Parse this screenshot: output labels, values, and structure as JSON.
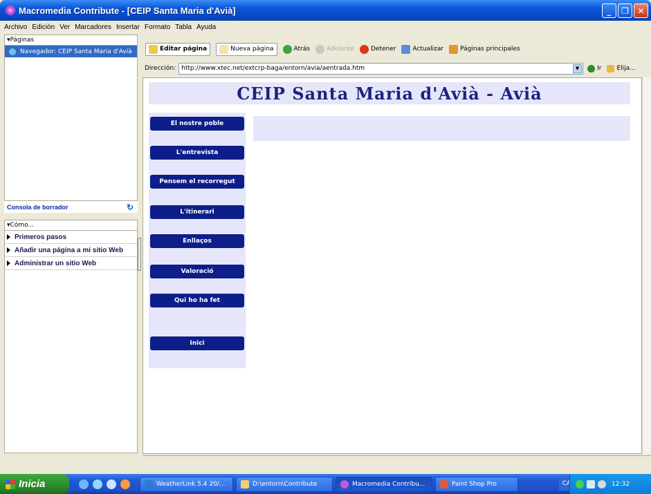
{
  "window": {
    "title": "Macromedia Contribute - [CEIP Santa Maria d'Avià]"
  },
  "menubar": [
    "Archivo",
    "Edición",
    "Ver",
    "Marcadores",
    "Insertar",
    "Formato",
    "Tabla",
    "Ayuda"
  ],
  "left": {
    "pages_header": "▾Páginas",
    "nav_item": "Navegador: CEIP Santa Maria d'Avià",
    "consola": "Consola de borrador",
    "como_header": "▾Cómo...",
    "como_items": [
      "Primeros pasos",
      "Añadir una página a mi sitio Web",
      "Administrar un sitio Web"
    ]
  },
  "toolbar": {
    "edit": "Editar página",
    "new": "Nueva página",
    "back": "Atrás",
    "forward": "Adelante",
    "stop": "Detener",
    "refresh": "Actualizar",
    "home": "Páginas principales"
  },
  "address": {
    "label": "Dirección:",
    "url": "http://www.xtec.net/extcrp-baga/entorn/avia/aentrada.htm",
    "go": "Ir",
    "choose": "Elija..."
  },
  "page": {
    "banner": "CEIP Santa Maria d'Avià - Avià",
    "menu": [
      "El nostre poble",
      "L'entrevista",
      "Pensem el recorregut",
      "L'itinerari",
      "Enllaços",
      "Valoració",
      "Qui ho ha fet",
      "Inici"
    ]
  },
  "taskbar": {
    "start": "Inicia",
    "tasks": [
      "WeatherLink 5.4 20/...",
      "D:\\entorn\\Contribute",
      "Macromedia Contribu...",
      "Paint Shop Pro"
    ],
    "lang": "CA",
    "clock": "12:32"
  },
  "colors": {
    "nav_button": "#0d1e8a",
    "page_tint": "#e6e6fa",
    "selection": "#316ac5"
  }
}
